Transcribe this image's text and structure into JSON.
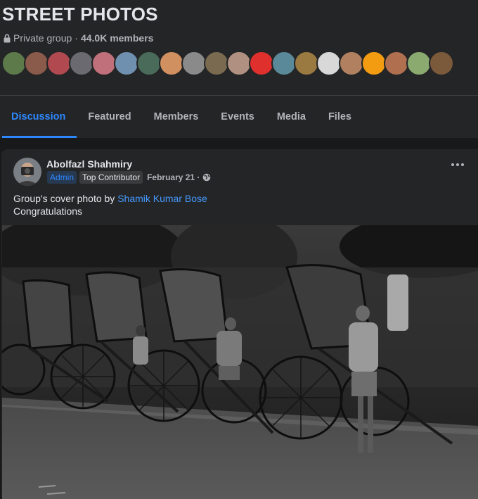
{
  "group": {
    "name": "STREET PHOTOS",
    "privacy": "Private group",
    "separator": "·",
    "members": "44.0K members"
  },
  "member_avatars": [
    {
      "color": "#5d7a4a"
    },
    {
      "color": "#8a5a4a"
    },
    {
      "color": "#b04a50"
    },
    {
      "color": "#6a6a70"
    },
    {
      "color": "#c0707a"
    },
    {
      "color": "#7090b0"
    },
    {
      "color": "#4a6a5a"
    },
    {
      "color": "#d09060"
    },
    {
      "color": "#8a8a8a"
    },
    {
      "color": "#7a6a50"
    },
    {
      "color": "#b09080"
    },
    {
      "color": "#e0302e"
    },
    {
      "color": "#5a8a9a"
    },
    {
      "color": "#9a7a40"
    },
    {
      "color": "#d8d8d8"
    },
    {
      "color": "#b08060"
    },
    {
      "color": "#f39c12"
    },
    {
      "color": "#b07050"
    },
    {
      "color": "#8aaa70"
    },
    {
      "color": "#7a5a3a"
    }
  ],
  "tabs": [
    {
      "label": "Discussion",
      "active": true
    },
    {
      "label": "Featured",
      "active": false
    },
    {
      "label": "Members",
      "active": false
    },
    {
      "label": "Events",
      "active": false
    },
    {
      "label": "Media",
      "active": false
    },
    {
      "label": "Files",
      "active": false
    }
  ],
  "post": {
    "author": "Abolfazl Shahmiry",
    "badge_admin": "Admin",
    "badge_contributor": "Top Contributor",
    "date": "February 21 ·",
    "text_prefix": "Group's cover photo by",
    "text_link": "Shamik Kumar Bose",
    "text_line2": "Congratulations"
  },
  "colors": {
    "accent": "#2d88ff",
    "background": "#18191a",
    "card": "#242526"
  },
  "icons": {
    "lock": "lock-icon",
    "globe": "globe-icon",
    "more": "more-options-icon"
  }
}
